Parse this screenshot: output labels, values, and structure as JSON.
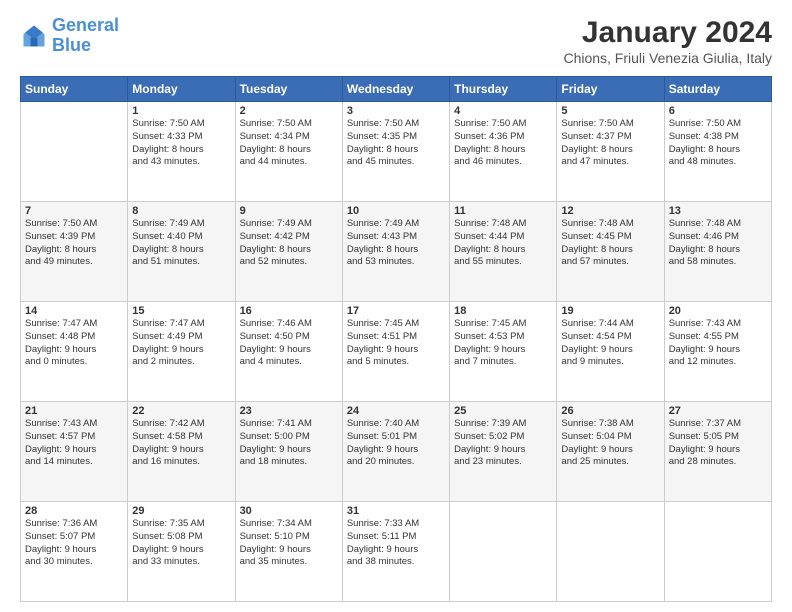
{
  "logo": {
    "line1": "General",
    "line2": "Blue"
  },
  "title": "January 2024",
  "subtitle": "Chions, Friuli Venezia Giulia, Italy",
  "weekdays": [
    "Sunday",
    "Monday",
    "Tuesday",
    "Wednesday",
    "Thursday",
    "Friday",
    "Saturday"
  ],
  "rows": [
    [
      {
        "day": "",
        "info": ""
      },
      {
        "day": "1",
        "info": "Sunrise: 7:50 AM\nSunset: 4:33 PM\nDaylight: 8 hours\nand 43 minutes."
      },
      {
        "day": "2",
        "info": "Sunrise: 7:50 AM\nSunset: 4:34 PM\nDaylight: 8 hours\nand 44 minutes."
      },
      {
        "day": "3",
        "info": "Sunrise: 7:50 AM\nSunset: 4:35 PM\nDaylight: 8 hours\nand 45 minutes."
      },
      {
        "day": "4",
        "info": "Sunrise: 7:50 AM\nSunset: 4:36 PM\nDaylight: 8 hours\nand 46 minutes."
      },
      {
        "day": "5",
        "info": "Sunrise: 7:50 AM\nSunset: 4:37 PM\nDaylight: 8 hours\nand 47 minutes."
      },
      {
        "day": "6",
        "info": "Sunrise: 7:50 AM\nSunset: 4:38 PM\nDaylight: 8 hours\nand 48 minutes."
      }
    ],
    [
      {
        "day": "7",
        "info": "Sunrise: 7:50 AM\nSunset: 4:39 PM\nDaylight: 8 hours\nand 49 minutes."
      },
      {
        "day": "8",
        "info": "Sunrise: 7:49 AM\nSunset: 4:40 PM\nDaylight: 8 hours\nand 51 minutes."
      },
      {
        "day": "9",
        "info": "Sunrise: 7:49 AM\nSunset: 4:42 PM\nDaylight: 8 hours\nand 52 minutes."
      },
      {
        "day": "10",
        "info": "Sunrise: 7:49 AM\nSunset: 4:43 PM\nDaylight: 8 hours\nand 53 minutes."
      },
      {
        "day": "11",
        "info": "Sunrise: 7:48 AM\nSunset: 4:44 PM\nDaylight: 8 hours\nand 55 minutes."
      },
      {
        "day": "12",
        "info": "Sunrise: 7:48 AM\nSunset: 4:45 PM\nDaylight: 8 hours\nand 57 minutes."
      },
      {
        "day": "13",
        "info": "Sunrise: 7:48 AM\nSunset: 4:46 PM\nDaylight: 8 hours\nand 58 minutes."
      }
    ],
    [
      {
        "day": "14",
        "info": "Sunrise: 7:47 AM\nSunset: 4:48 PM\nDaylight: 9 hours\nand 0 minutes."
      },
      {
        "day": "15",
        "info": "Sunrise: 7:47 AM\nSunset: 4:49 PM\nDaylight: 9 hours\nand 2 minutes."
      },
      {
        "day": "16",
        "info": "Sunrise: 7:46 AM\nSunset: 4:50 PM\nDaylight: 9 hours\nand 4 minutes."
      },
      {
        "day": "17",
        "info": "Sunrise: 7:45 AM\nSunset: 4:51 PM\nDaylight: 9 hours\nand 5 minutes."
      },
      {
        "day": "18",
        "info": "Sunrise: 7:45 AM\nSunset: 4:53 PM\nDaylight: 9 hours\nand 7 minutes."
      },
      {
        "day": "19",
        "info": "Sunrise: 7:44 AM\nSunset: 4:54 PM\nDaylight: 9 hours\nand 9 minutes."
      },
      {
        "day": "20",
        "info": "Sunrise: 7:43 AM\nSunset: 4:55 PM\nDaylight: 9 hours\nand 12 minutes."
      }
    ],
    [
      {
        "day": "21",
        "info": "Sunrise: 7:43 AM\nSunset: 4:57 PM\nDaylight: 9 hours\nand 14 minutes."
      },
      {
        "day": "22",
        "info": "Sunrise: 7:42 AM\nSunset: 4:58 PM\nDaylight: 9 hours\nand 16 minutes."
      },
      {
        "day": "23",
        "info": "Sunrise: 7:41 AM\nSunset: 5:00 PM\nDaylight: 9 hours\nand 18 minutes."
      },
      {
        "day": "24",
        "info": "Sunrise: 7:40 AM\nSunset: 5:01 PM\nDaylight: 9 hours\nand 20 minutes."
      },
      {
        "day": "25",
        "info": "Sunrise: 7:39 AM\nSunset: 5:02 PM\nDaylight: 9 hours\nand 23 minutes."
      },
      {
        "day": "26",
        "info": "Sunrise: 7:38 AM\nSunset: 5:04 PM\nDaylight: 9 hours\nand 25 minutes."
      },
      {
        "day": "27",
        "info": "Sunrise: 7:37 AM\nSunset: 5:05 PM\nDaylight: 9 hours\nand 28 minutes."
      }
    ],
    [
      {
        "day": "28",
        "info": "Sunrise: 7:36 AM\nSunset: 5:07 PM\nDaylight: 9 hours\nand 30 minutes."
      },
      {
        "day": "29",
        "info": "Sunrise: 7:35 AM\nSunset: 5:08 PM\nDaylight: 9 hours\nand 33 minutes."
      },
      {
        "day": "30",
        "info": "Sunrise: 7:34 AM\nSunset: 5:10 PM\nDaylight: 9 hours\nand 35 minutes."
      },
      {
        "day": "31",
        "info": "Sunrise: 7:33 AM\nSunset: 5:11 PM\nDaylight: 9 hours\nand 38 minutes."
      },
      {
        "day": "",
        "info": ""
      },
      {
        "day": "",
        "info": ""
      },
      {
        "day": "",
        "info": ""
      }
    ]
  ]
}
